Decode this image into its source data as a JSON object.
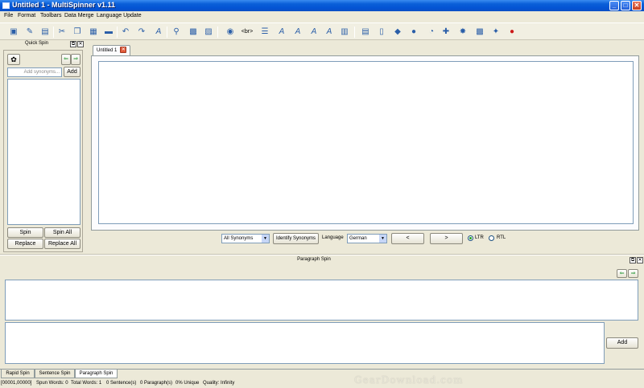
{
  "window": {
    "title": "Untitled 1 - MultiSpinner v1.11",
    "minimize": "_",
    "maximize": "□",
    "close": "✕"
  },
  "menu": [
    "File",
    "Format",
    "Toolbars",
    "Data Merge",
    "Language Update"
  ],
  "toolbar": {
    "br_label": "<br>"
  },
  "quick_spin": {
    "title": "Quick Spin",
    "synonyms_placeholder": "Add synonyms...",
    "add_label": "Add",
    "spin_label": "Spin",
    "spin_all_label": "Spin All",
    "replace_label": "Replace",
    "replace_all_label": "Replace All"
  },
  "editor": {
    "tab_label": "Untitled 1",
    "synonym_filter": "All Synonyms",
    "identify_label": "Identify Synonyms",
    "language_label": "Language",
    "language_value": "German",
    "prev_label": "<",
    "next_label": ">",
    "ltr_label": "LTR",
    "rtl_label": "RTL"
  },
  "paragraph_spin": {
    "title": "Paragraph Spin",
    "add_label": "Add"
  },
  "bottom_tabs": [
    "Rapid Spin",
    "Sentence Spin",
    "Paragraph Spin"
  ],
  "status": {
    "position": "[00001,00000]",
    "spun_words": "Spun Words: 0",
    "total_words": "Total Words: 1",
    "sentences": "0 Sentence(s)",
    "paragraphs": "0 Paragraph(s)",
    "unique": "0% Unique",
    "quality": "Quality: Infinity"
  },
  "watermark": "GearDownload.com"
}
